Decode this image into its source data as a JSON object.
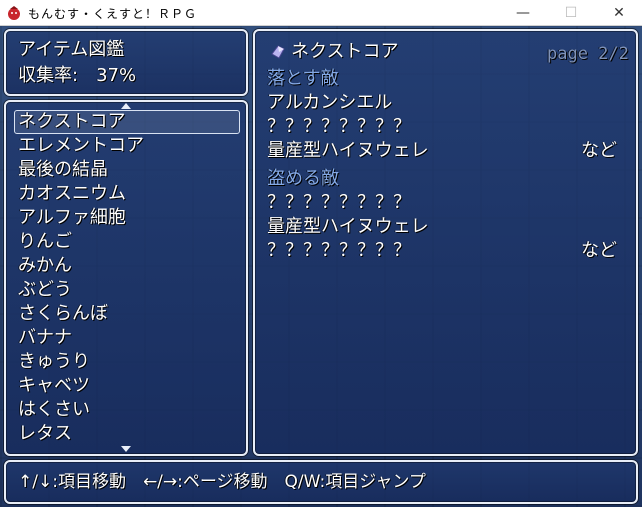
{
  "window": {
    "title": "もんむす・くえすと！ＲＰＧ",
    "minimize": "—",
    "maximize": "☐",
    "close": "✕"
  },
  "info_panel": {
    "title": "アイテム図鑑",
    "collection": "収集率:　37%"
  },
  "item_list": {
    "items": [
      "ネクストコア",
      "エレメントコア",
      "最後の結晶",
      "カオスニウム",
      "アルファ細胞",
      "りんご",
      "みかん",
      "ぶどう",
      "さくらんぼ",
      "バナナ",
      "きゅうり",
      "キャベツ",
      "はくさい",
      "レタス"
    ],
    "selected_index": 0
  },
  "detail": {
    "icon": "crystal-icon",
    "name": "ネクストコア",
    "page": "page 2/2",
    "drop_header": "落とす敵",
    "drop_enemies": [
      "アルカンシエル",
      "？？？？？？？？",
      "量産型ハイヌウェレ"
    ],
    "drop_more": "など",
    "steal_header": "盗める敵",
    "steal_enemies": [
      "？？？？？？？？",
      "量産型ハイヌウェレ",
      "？？？？？？？？"
    ],
    "steal_more": "など"
  },
  "help": {
    "text": "↑/↓:項目移動　←/→:ページ移動　Q/W:項目ジャンプ"
  },
  "colors": {
    "system_text": "#84a9e6",
    "normal_text": "#ffffff",
    "window_border": "#e8eef8"
  }
}
